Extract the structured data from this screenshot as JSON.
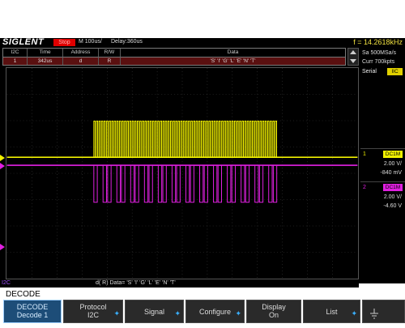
{
  "topbar": {
    "brand": "SIGLENT",
    "status": "Stop",
    "timebase": "M 100us/",
    "delay": "Delay:360us",
    "frequency": "f = 14.2618kHz"
  },
  "decode_table": {
    "headers": [
      "I2C",
      "Time",
      "Address",
      "R/W",
      "Data"
    ],
    "rows": [
      [
        "1",
        "342us",
        "d",
        "R",
        "'S' 'I' 'G' 'L' 'E' 'N' 'T'"
      ]
    ]
  },
  "acquisition": {
    "sample_rate": "Sa 500MSa/s",
    "memory": "Curr 700kpts",
    "serial_label": "Serial",
    "serial_value": "IIC"
  },
  "channels": [
    {
      "number": "1",
      "coupling": "DC1M",
      "scale": "2.00 V/",
      "offset": "-840 mV",
      "color": "#f0f000"
    },
    {
      "number": "2",
      "coupling": "DC1M",
      "scale": "2.00 V/",
      "offset": "-4.60 V",
      "color": "#e020e0"
    }
  ],
  "bus": {
    "name": "I2C",
    "data_text": "d( R) Data= 'S' 'I' 'G' 'L' 'E' 'N' 'T'"
  },
  "menu": {
    "title": "DECODE",
    "softkeys": [
      {
        "line1": "DECODE",
        "line2": "Decode 1"
      },
      {
        "line1": "Protocol",
        "line2": "I2C"
      },
      {
        "line1": "Signal",
        "line2": ""
      },
      {
        "line1": "Configure",
        "line2": ""
      },
      {
        "line1": "Display",
        "line2": "On"
      },
      {
        "line1": "List",
        "line2": ""
      }
    ]
  },
  "colors": {
    "ch1": "#f0f000",
    "ch2": "#e020e0",
    "accent": "#1d4d78"
  },
  "icons": [
    "trigger-level-marker",
    "ground-symbol-icon",
    "scroll-up-icon",
    "scroll-down-icon"
  ]
}
